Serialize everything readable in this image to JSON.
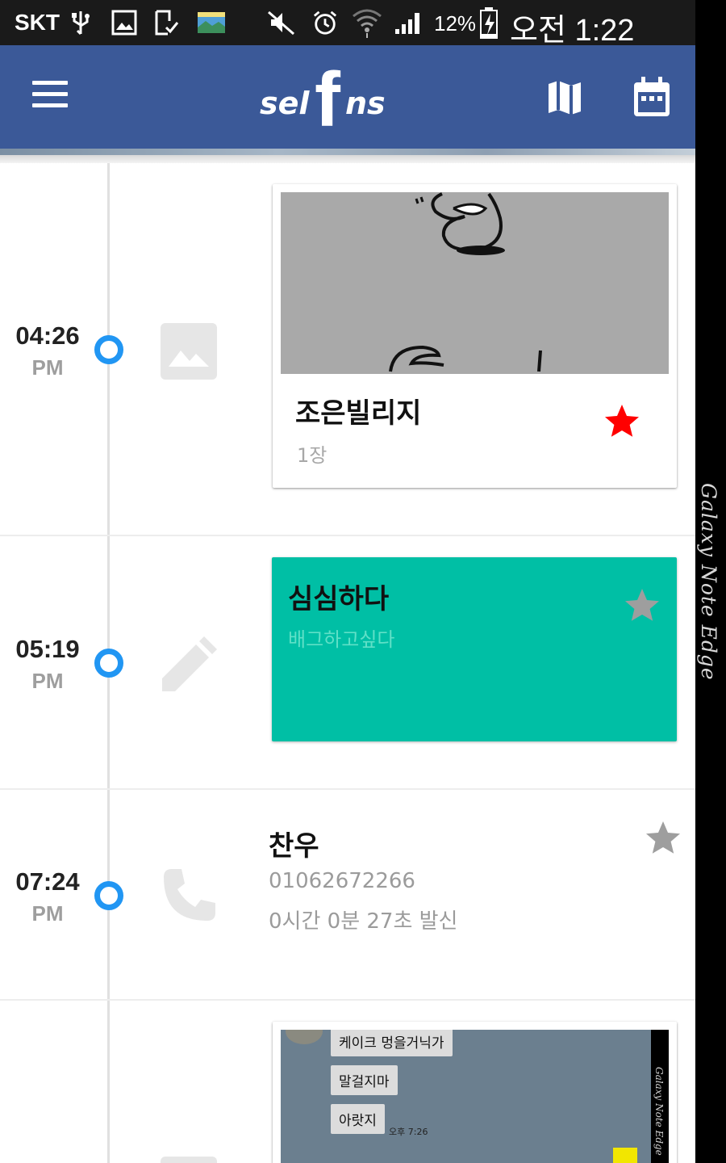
{
  "status_bar": {
    "carrier": "SKT",
    "battery_percent": "12%",
    "time": "오전 1:22",
    "icons": [
      "usb-icon",
      "image-icon",
      "download-done-icon",
      "gallery-thumbnail-icon",
      "mute-icon",
      "alarm-icon",
      "wifi-icon",
      "signal-icon",
      "battery-charging-icon"
    ]
  },
  "edge_screen": {
    "text": "Galaxy Note Edge"
  },
  "app_bar": {
    "logo": {
      "left": "sel",
      "middle": "f",
      "right": "ns"
    },
    "left_icon": "menu-icon",
    "right_icons": [
      "map-icon",
      "calendar-icon"
    ],
    "color": "#3b5998"
  },
  "timeline": {
    "entries": [
      {
        "time": "04:26",
        "ampm": "PM",
        "type_icon": "image-icon",
        "title": "조은빌리지",
        "subtitle": "1장",
        "starred": true,
        "star_color": "#ff0000"
      },
      {
        "time": "05:19",
        "ampm": "PM",
        "type_icon": "pencil-icon",
        "title": "심심하다",
        "subtitle": "배그하고싶다",
        "starred": false,
        "card_color": "#00bfa5"
      },
      {
        "time": "07:24",
        "ampm": "PM",
        "type_icon": "phone-icon",
        "name": "찬우",
        "number": "01062672266",
        "duration": "0시간 0분 27초 발신",
        "starred": false
      },
      {
        "type_icon": "image-icon",
        "chat_preview": {
          "bubbles": [
            "케이크 멍을거닉가",
            "말걸지마",
            "아랏지"
          ],
          "time": "오후 7:26",
          "edge_text": "Galaxy Note Edge"
        }
      }
    ]
  },
  "colors": {
    "dot": "#2196f3",
    "star_gray": "#9e9e9e",
    "star_active": "#ff0000"
  }
}
